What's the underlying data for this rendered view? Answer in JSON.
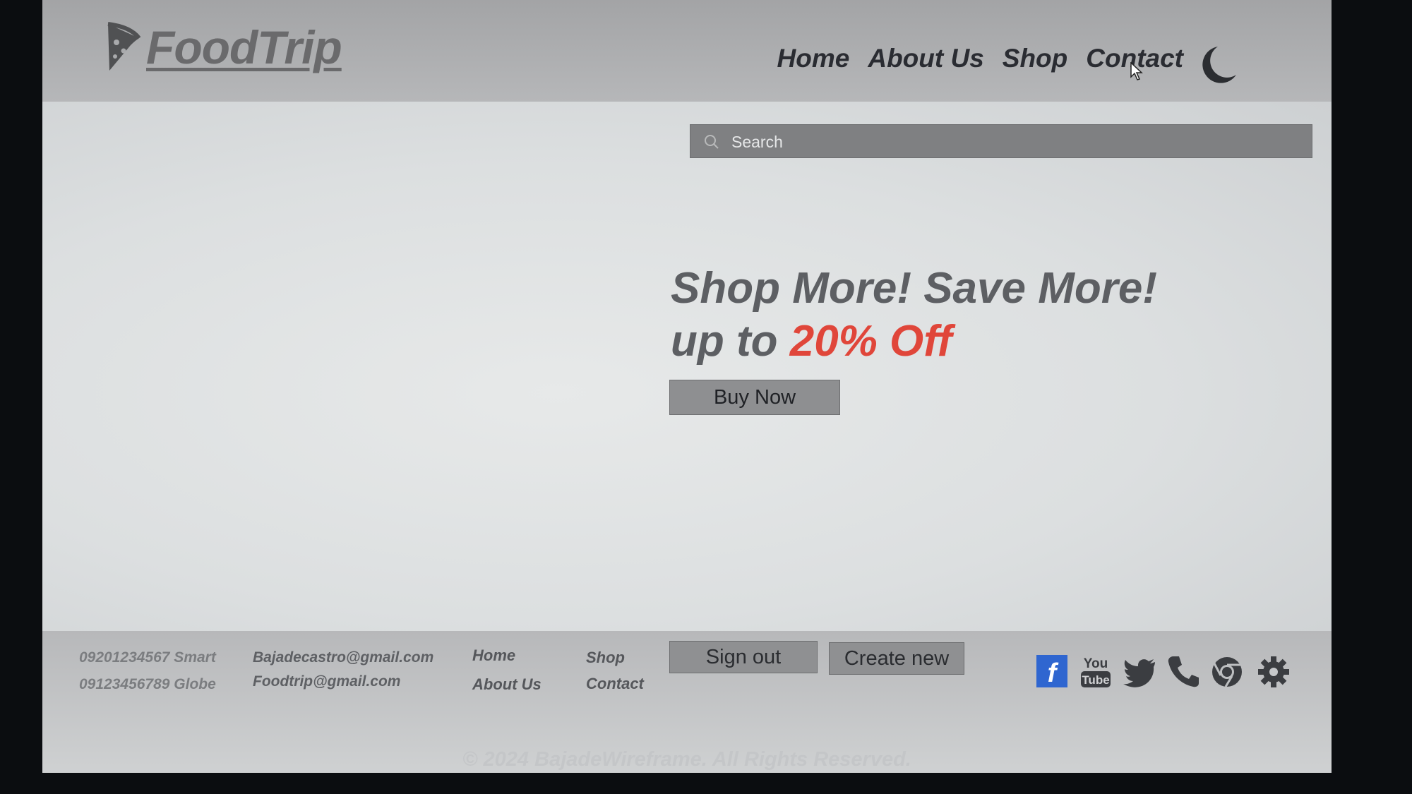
{
  "header": {
    "logo_text": "FoodTrip",
    "nav": [
      "Home",
      "About Us",
      "Shop",
      "Contact"
    ]
  },
  "search": {
    "placeholder": "Search"
  },
  "promo": {
    "headline": "Shop More! Save More!",
    "sub_prefix": "up to ",
    "discount": "20% Off",
    "button": "Buy Now",
    "discount_color": "#e0463a"
  },
  "footer": {
    "phones": [
      "09201234567 Smart",
      "09123456789 Globe"
    ],
    "emails": [
      "Bajadecastro@gmail.com",
      "Foodtrip@gmail.com"
    ],
    "links": [
      "Home",
      "About Us",
      "Shop",
      "Contact"
    ],
    "sign_out": "Sign out",
    "create_new": "Create new",
    "social_icons": [
      "facebook-icon",
      "youtube-icon",
      "twitter-icon",
      "phone-icon",
      "chrome-icon",
      "gear-icon"
    ],
    "copyright": "© 2024 BajadeWireframe. All Rights Reserved."
  },
  "colors": {
    "header_bg": "#a9aaac",
    "page_bg": "#d7dadb",
    "search_bg": "#7f8082",
    "facebook": "#2f66d0"
  }
}
